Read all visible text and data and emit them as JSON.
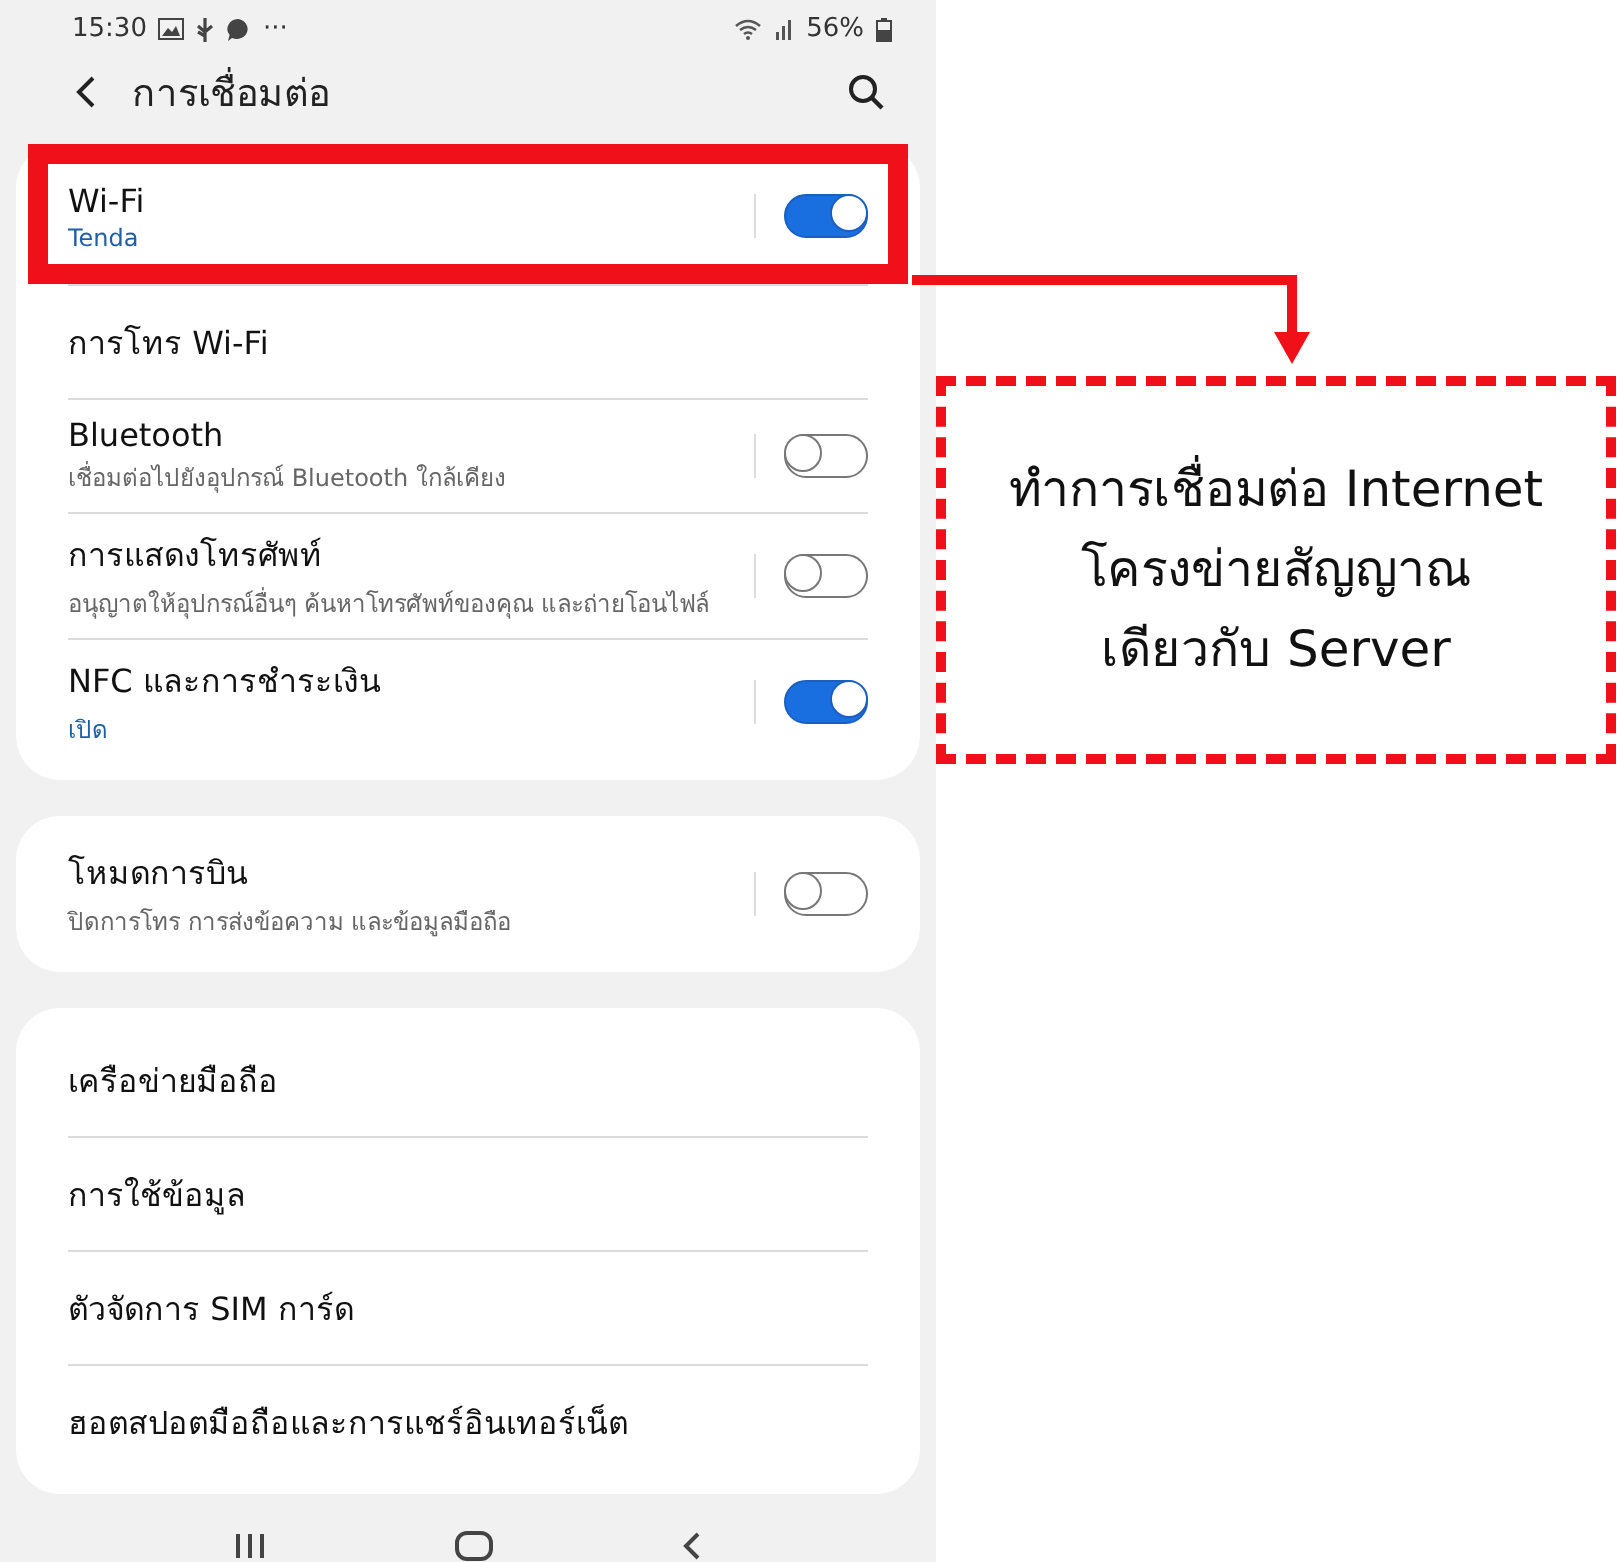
{
  "status_bar": {
    "time": "15:30",
    "more": "···",
    "battery": "56%"
  },
  "header": {
    "title": "การเชื่อมต่อ"
  },
  "groups": [
    {
      "items": [
        {
          "kind": "toggle",
          "title": "Wi-Fi",
          "subtitle": "Tenda",
          "on": true,
          "highlighted": true
        },
        {
          "kind": "link",
          "title": "การโทร Wi-Fi",
          "highlighted": false
        },
        {
          "kind": "toggle",
          "title": "Bluetooth",
          "subtitle": "เชื่อมต่อไปยังอุปกรณ์ Bluetooth ใกล้เคียง",
          "on": false,
          "highlighted": false
        },
        {
          "kind": "toggle",
          "title": "การแสดงโทรศัพท์",
          "subtitle": "อนุญาตให้อุปกรณ์อื่นๆ ค้นหาโทรศัพท์ของคุณ และถ่ายโอนไฟล์",
          "on": false,
          "highlighted": false
        },
        {
          "kind": "toggle",
          "title": "NFC และการชำระเงิน",
          "subtitle": "เปิด",
          "on": true,
          "highlighted": false
        }
      ]
    },
    {
      "items": [
        {
          "kind": "toggle",
          "title": "โหมดการบิน",
          "subtitle": "ปิดการโทร การส่งข้อความ และข้อมูลมือถือ",
          "on": false,
          "highlighted": false
        }
      ]
    },
    {
      "items": [
        {
          "kind": "link",
          "title": "เครือข่ายมือถือ",
          "highlighted": false
        },
        {
          "kind": "link",
          "title": "การใช้ข้อมูล",
          "highlighted": false
        },
        {
          "kind": "link",
          "title": "ตัวจัดการ SIM การ์ด",
          "highlighted": false
        },
        {
          "kind": "link",
          "title": "ฮอตสปอตมือถือและการแชร์อินเทอร์เน็ต",
          "highlighted": false
        }
      ]
    }
  ],
  "annotation": {
    "lines": [
      "ทำการเชื่อมต่อ Internet",
      "โครงข่ายสัญญาณ",
      "เดียวกับ Server"
    ]
  }
}
